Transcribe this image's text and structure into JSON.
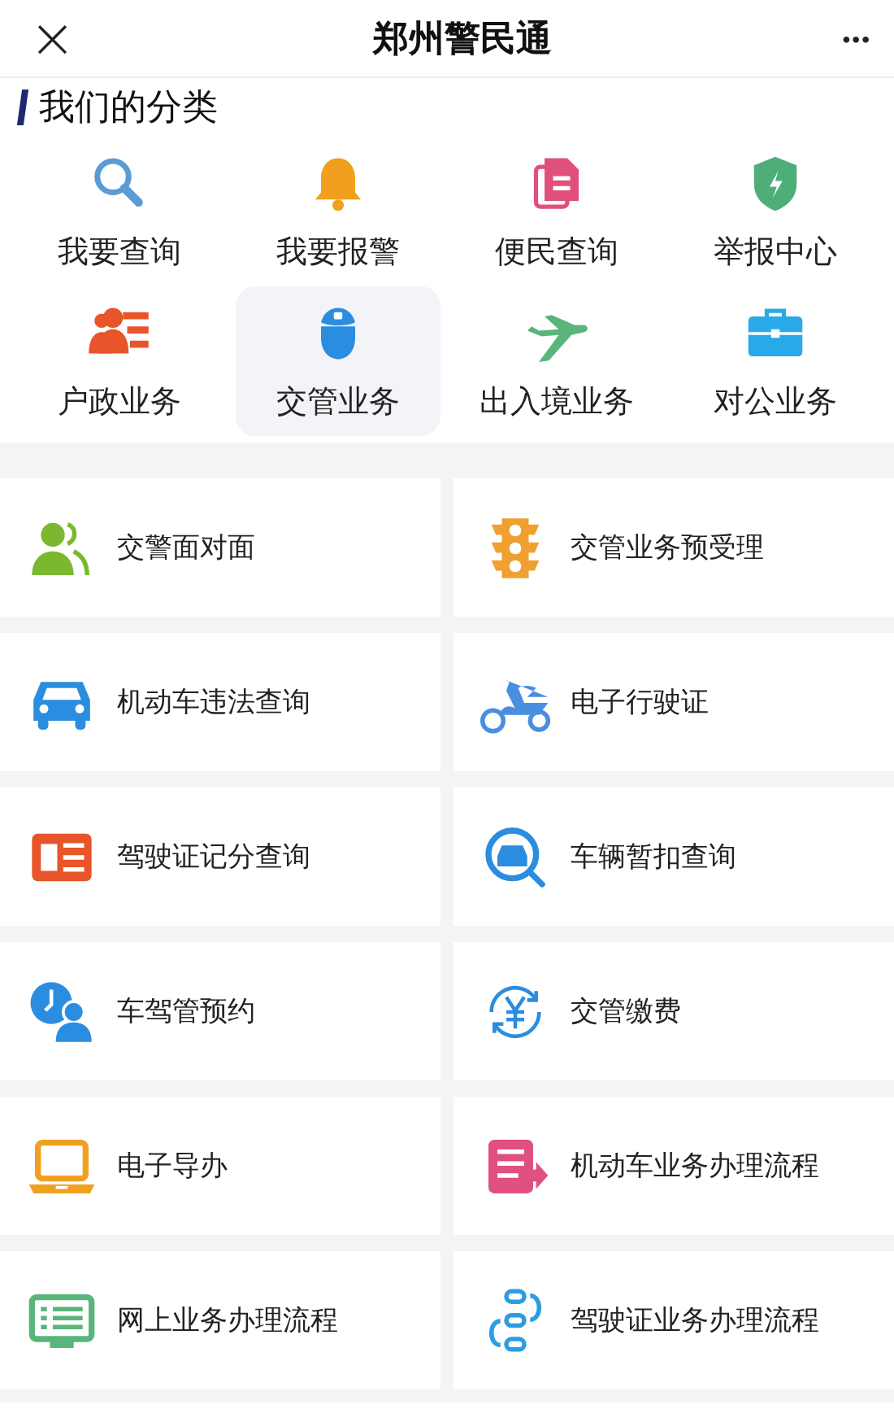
{
  "header": {
    "close": "×",
    "title": "郑州警民通",
    "more": "•••"
  },
  "section": {
    "title": "我们的分类"
  },
  "categories": [
    {
      "label": "我要查询",
      "selected": false
    },
    {
      "label": "我要报警",
      "selected": false
    },
    {
      "label": "便民查询",
      "selected": false
    },
    {
      "label": "举报中心",
      "selected": false
    },
    {
      "label": "户政业务",
      "selected": false
    },
    {
      "label": "交管业务",
      "selected": true
    },
    {
      "label": "出入境业务",
      "selected": false
    },
    {
      "label": "对公业务",
      "selected": false
    }
  ],
  "services": [
    {
      "label": "交警面对面"
    },
    {
      "label": "交管业务预受理"
    },
    {
      "label": "机动车违法查询"
    },
    {
      "label": "电子行驶证"
    },
    {
      "label": "驾驶证记分查询"
    },
    {
      "label": "车辆暂扣查询"
    },
    {
      "label": "车驾管预约"
    },
    {
      "label": "交管缴费"
    },
    {
      "label": "电子导办"
    },
    {
      "label": "机动车业务办理流程"
    },
    {
      "label": "网上业务办理流程"
    },
    {
      "label": "驾驶证业务办理流程"
    }
  ]
}
